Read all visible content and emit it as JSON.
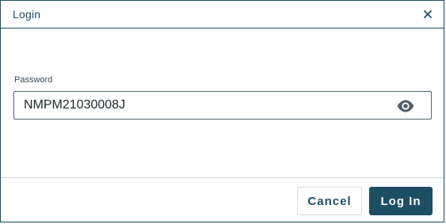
{
  "dialog": {
    "title": "Login",
    "close_icon": "close-icon"
  },
  "password_field": {
    "label": "Password",
    "value": "NMPM21030008J",
    "toggle_icon": "eye-icon"
  },
  "footer": {
    "cancel_label": "Cancel",
    "login_label": "Log In"
  },
  "colors": {
    "accent": "#1d4e63",
    "border": "#56656f",
    "divider": "#cfd6da"
  }
}
